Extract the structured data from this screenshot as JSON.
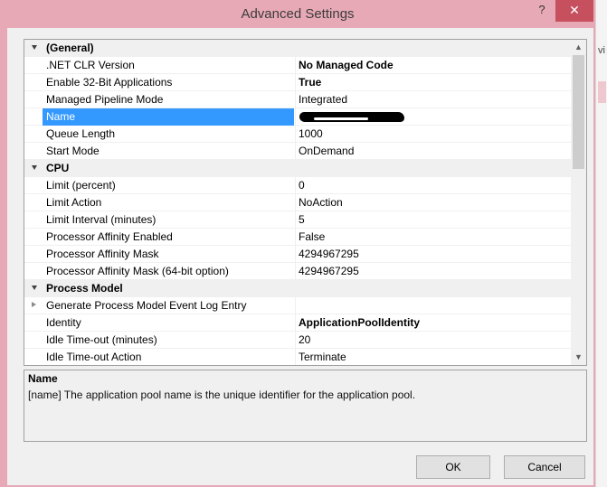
{
  "window": {
    "title": "Advanced Settings",
    "help_label": "?",
    "close_label": "✕"
  },
  "backdrop": {
    "fragment": "vi"
  },
  "properties": [
    {
      "type": "category",
      "label": "(General)",
      "expanded": true
    },
    {
      "type": "prop",
      "name": ".NET CLR Version",
      "value": "No Managed Code",
      "bold": true
    },
    {
      "type": "prop",
      "name": "Enable 32-Bit Applications",
      "value": "True",
      "bold": true
    },
    {
      "type": "prop",
      "name": "Managed Pipeline Mode",
      "value": "Integrated",
      "bold": false
    },
    {
      "type": "prop",
      "name": "Name",
      "value": "",
      "bold": false,
      "selected": true,
      "redacted": true
    },
    {
      "type": "prop",
      "name": "Queue Length",
      "value": "1000",
      "bold": false
    },
    {
      "type": "prop",
      "name": "Start Mode",
      "value": "OnDemand",
      "bold": false
    },
    {
      "type": "category",
      "label": "CPU",
      "expanded": true
    },
    {
      "type": "prop",
      "name": "Limit (percent)",
      "value": "0",
      "bold": false
    },
    {
      "type": "prop",
      "name": "Limit Action",
      "value": "NoAction",
      "bold": false
    },
    {
      "type": "prop",
      "name": "Limit Interval (minutes)",
      "value": "5",
      "bold": false
    },
    {
      "type": "prop",
      "name": "Processor Affinity Enabled",
      "value": "False",
      "bold": false
    },
    {
      "type": "prop",
      "name": "Processor Affinity Mask",
      "value": "4294967295",
      "bold": false
    },
    {
      "type": "prop",
      "name": "Processor Affinity Mask (64-bit option)",
      "value": "4294967295",
      "bold": false
    },
    {
      "type": "category",
      "label": "Process Model",
      "expanded": true
    },
    {
      "type": "prop",
      "name": "Generate Process Model Event Log Entry",
      "value": "",
      "bold": false,
      "expandable": true
    },
    {
      "type": "prop",
      "name": "Identity",
      "value": "ApplicationPoolIdentity",
      "bold": true
    },
    {
      "type": "prop",
      "name": "Idle Time-out (minutes)",
      "value": "20",
      "bold": false
    },
    {
      "type": "prop",
      "name": "Idle Time-out Action",
      "value": "Terminate",
      "bold": false
    }
  ],
  "description": {
    "title": "Name",
    "text": "[name] The application pool name is the unique identifier for the application pool."
  },
  "buttons": {
    "ok": "OK",
    "cancel": "Cancel"
  },
  "scroll": {
    "position_fraction": 0.0
  },
  "colors": {
    "frame": "#e7a9b6",
    "selection": "#3399ff",
    "close_button": "#c7505f"
  }
}
